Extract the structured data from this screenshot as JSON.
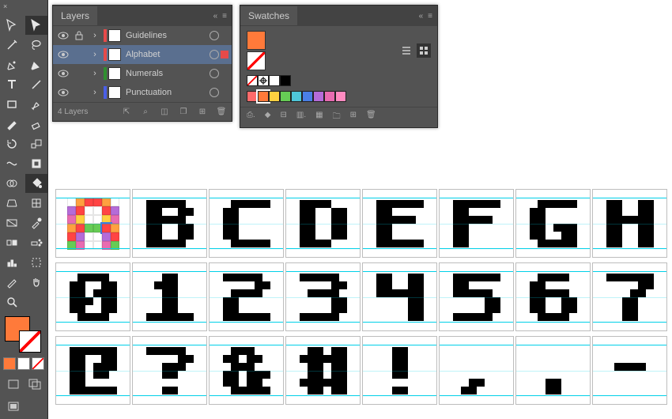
{
  "toolbar": {
    "close": "×"
  },
  "layers_panel": {
    "tab_label": "Layers",
    "close": "×",
    "menu": "≡",
    "layers": [
      {
        "name": "Guidelines",
        "color": "#e64a4a",
        "selected": false,
        "locked": true
      },
      {
        "name": "Alphabet",
        "color": "#e64a4a",
        "selected": true,
        "locked": false
      },
      {
        "name": "Numerals",
        "color": "#2f8f2f",
        "selected": false,
        "locked": false
      },
      {
        "name": "Punctuation",
        "color": "#4a5fe6",
        "selected": false,
        "locked": false
      }
    ],
    "footer_label": "4 Layers"
  },
  "swatches_panel": {
    "tab_label": "Swatches",
    "close": "×",
    "menu": "≡",
    "colors_row": [
      "#ffffff",
      "#000000",
      "#ff7a3a",
      "#ffd040",
      "#66cc55",
      "#4ec6d8",
      "#4a7fe6",
      "#b56bd8",
      "#e86bb0",
      "#ff6b6b"
    ]
  },
  "fill_color": "#ff7a3a",
  "mini_colors": [
    "#ff7a3a",
    "#ffffff",
    "#ffffff"
  ],
  "glyph_rows": [
    [
      "A",
      "B",
      "C",
      "D",
      "E",
      "F",
      "G",
      "H"
    ],
    [
      "0",
      "1",
      "2",
      "3",
      "4",
      "5",
      "6",
      "7"
    ],
    [
      "@",
      "?",
      "&",
      "#",
      "!",
      ",",
      ".",
      "-"
    ]
  ]
}
